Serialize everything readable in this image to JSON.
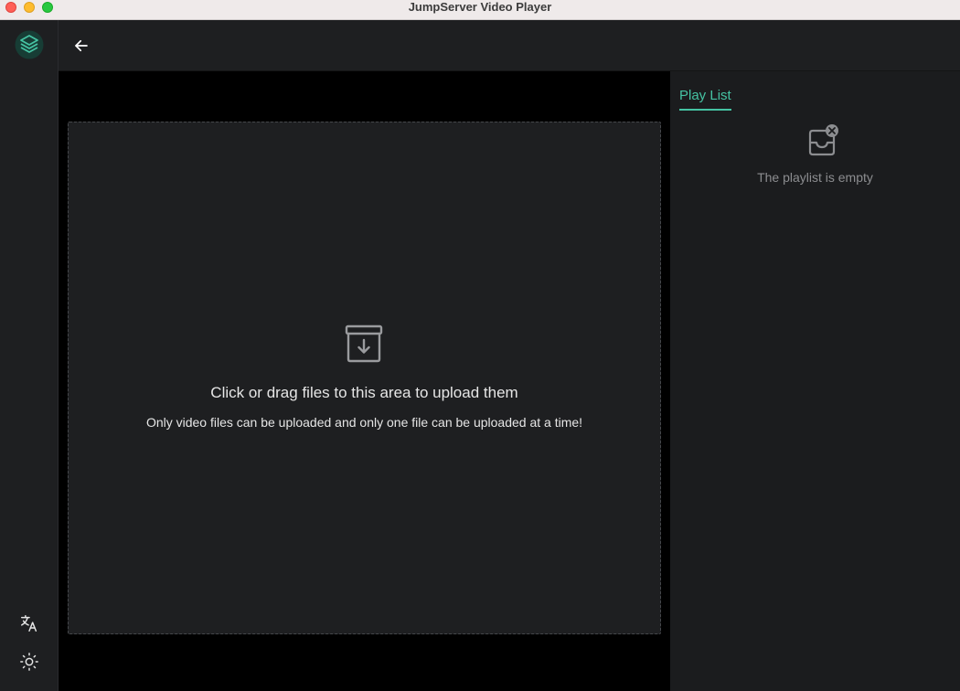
{
  "window": {
    "title": "JumpServer Video Player"
  },
  "theme": {
    "accent": "#45c3a3",
    "background": "#000000",
    "panel": "#1e1f21",
    "text": "#e6e6e6",
    "muted_text": "#8c8d90"
  },
  "sidebar": {
    "logo_icon": "jumpserver-logo-icon",
    "language_icon": "translate-icon",
    "theme_icon": "sun-icon"
  },
  "header": {
    "back_icon": "arrow-left-icon"
  },
  "upload": {
    "icon": "archive-download-icon",
    "title": "Click or drag files to this area to upload them",
    "hint": "Only video files can be uploaded and only one file can be uploaded at a time!"
  },
  "playlist": {
    "tab_label": "Play List",
    "empty_icon": "empty-inbox-icon",
    "empty_text": "The playlist is empty"
  }
}
